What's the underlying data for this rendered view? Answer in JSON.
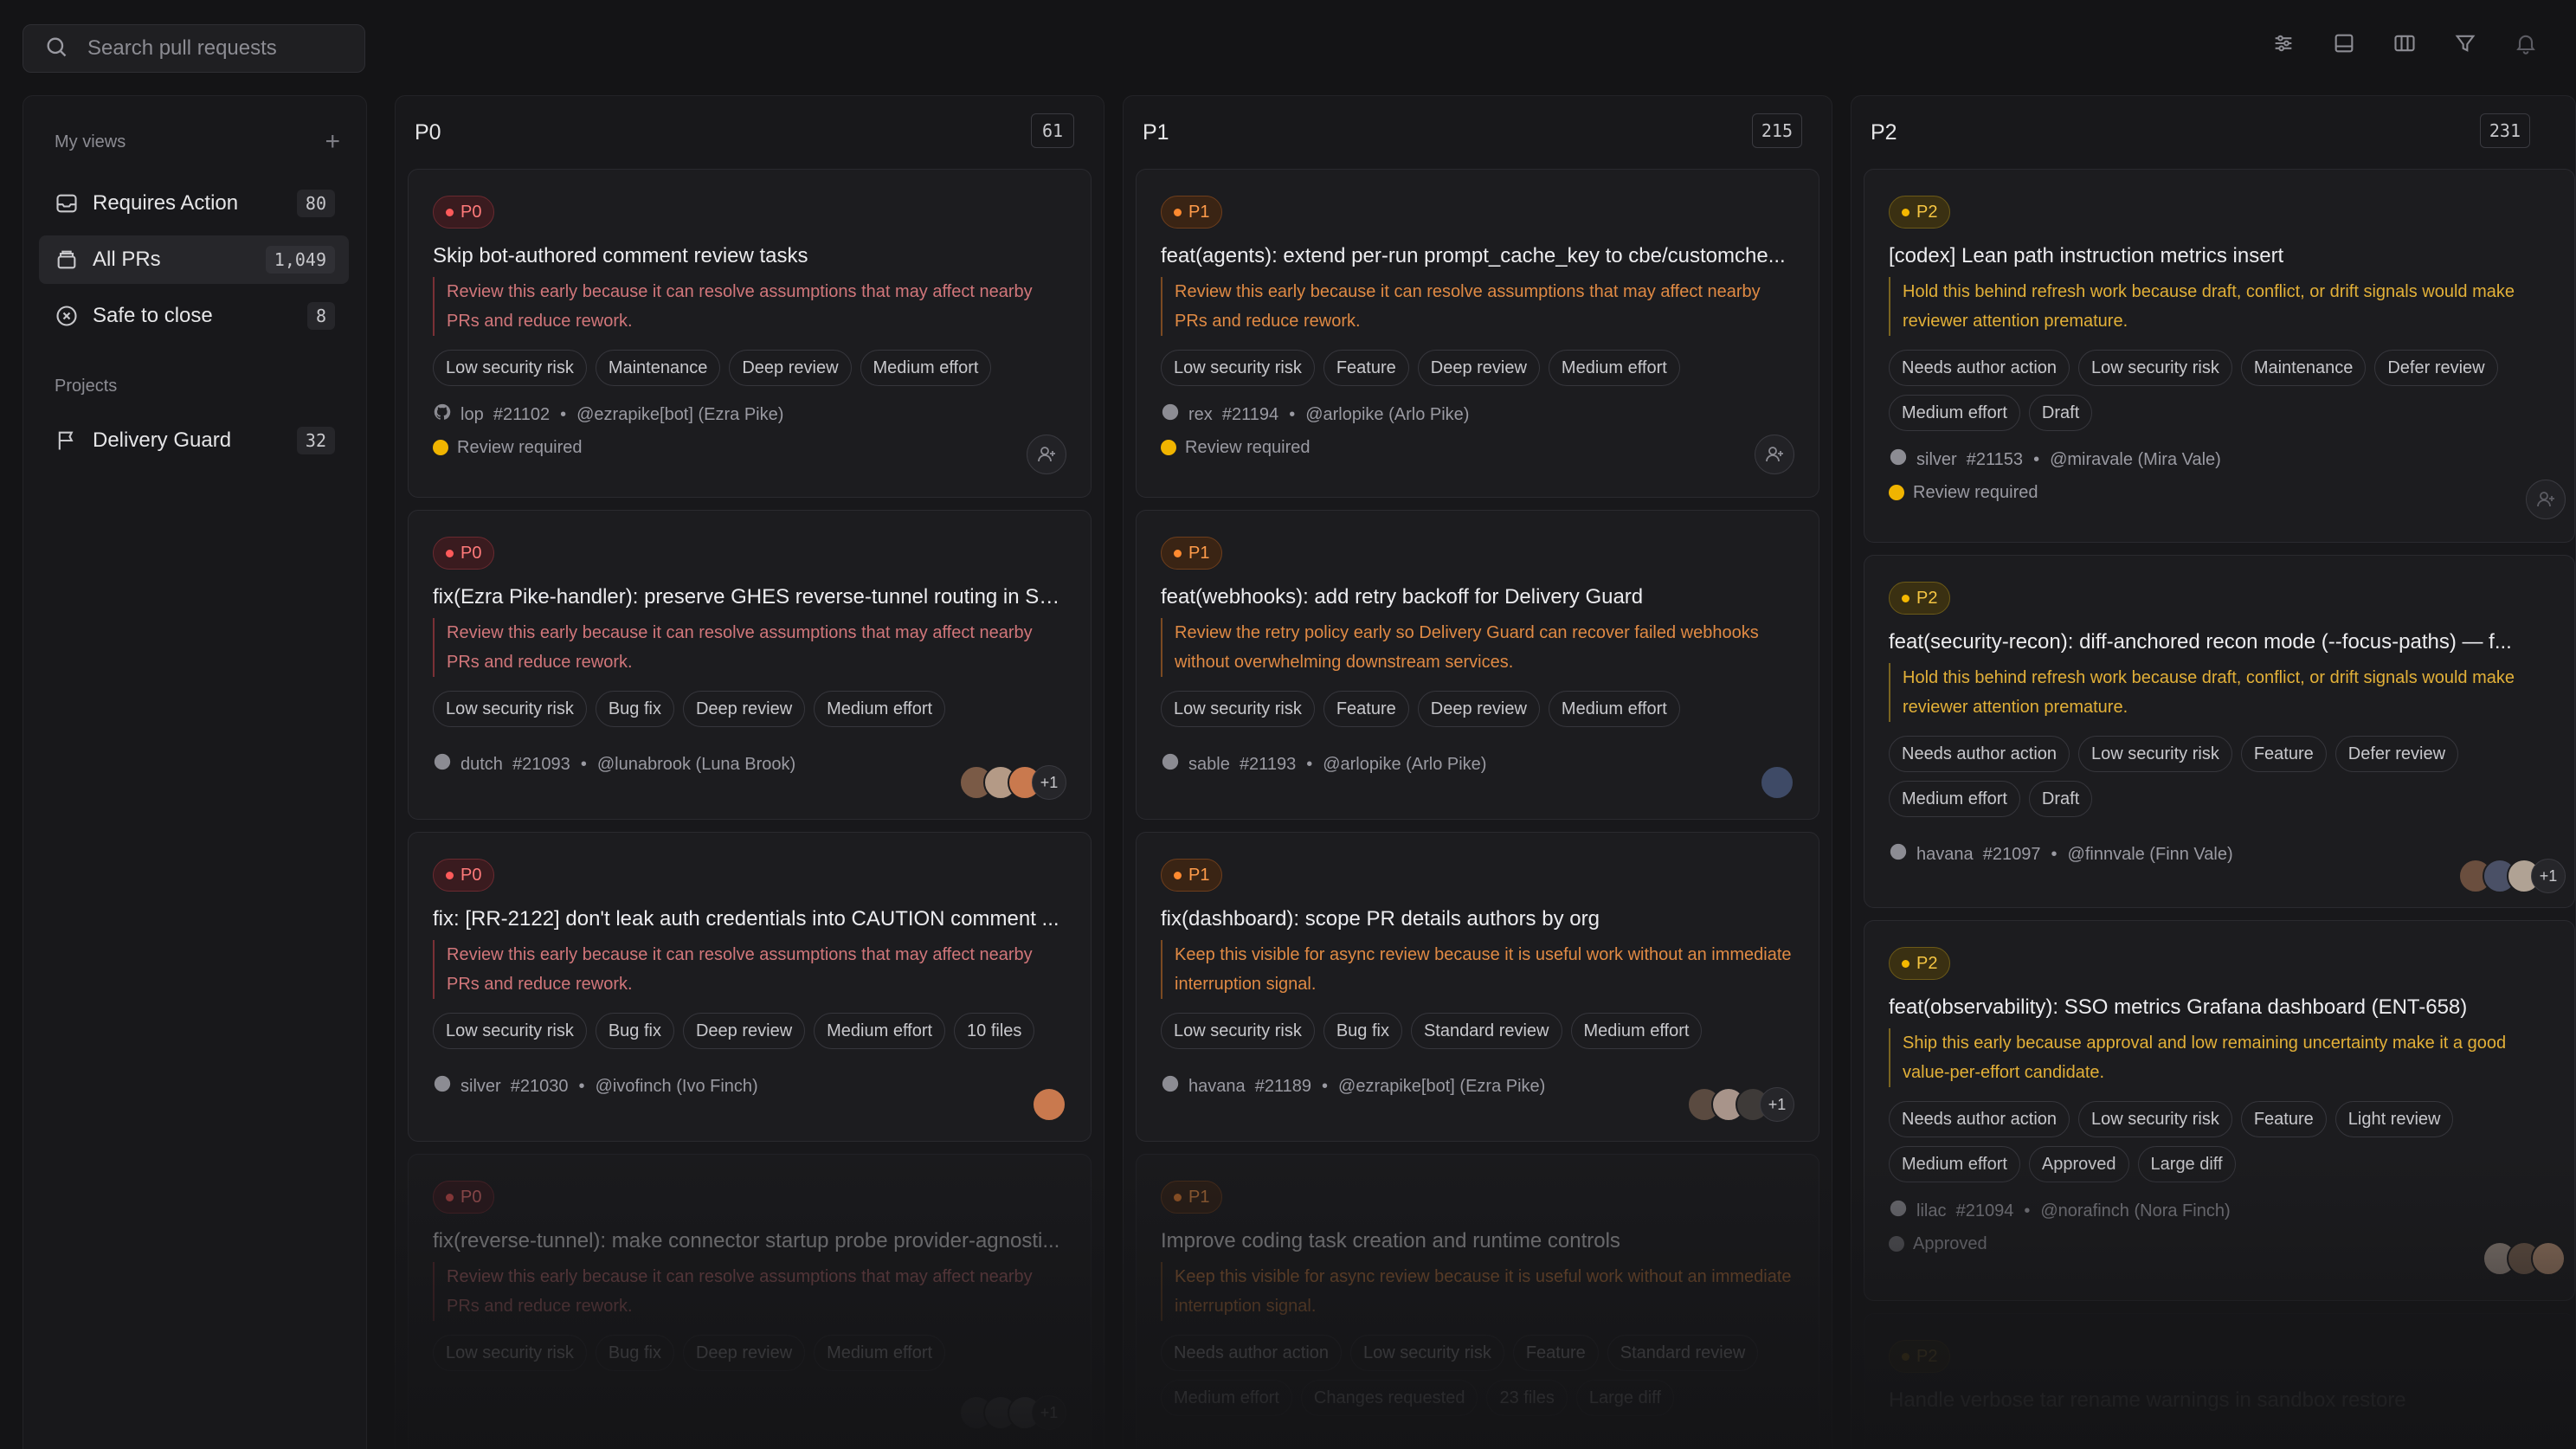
{
  "search": {
    "placeholder": "Search pull requests"
  },
  "toolbar": {
    "icons": [
      "sliders-icon",
      "layout-icon",
      "columns-icon",
      "filter-icon",
      "bell-icon"
    ]
  },
  "sidebar": {
    "my_views_label": "My views",
    "add_label": "+",
    "views": [
      {
        "label": "Requires Action",
        "count": "80",
        "icon": "inbox-icon"
      },
      {
        "label": "All PRs",
        "count": "1,049",
        "icon": "stack-icon"
      },
      {
        "label": "Safe to close",
        "count": "8",
        "icon": "close-circle-icon"
      }
    ],
    "projects_label": "Projects",
    "projects": [
      {
        "label": "Delivery Guard",
        "count": "32",
        "icon": "flag-icon"
      }
    ]
  },
  "colors": {
    "p0": "#ff5a5a",
    "p1": "#ff8a30",
    "p2": "#f5b800",
    "background": "#141416"
  },
  "columns": [
    {
      "title": "P0",
      "count": "61",
      "cards": [
        {
          "badge": "P0",
          "title": "Skip bot-authored comment review tasks",
          "note": "Review this early because it can resolve assumptions that may affect nearby PRs and reduce rework.",
          "tags": [
            "Low security risk",
            "Maintenance",
            "Deep review",
            "Medium effort"
          ],
          "repo": "lop",
          "number": "#21102",
          "author": "@ezrapike[bot] (Ezra Pike)",
          "status": "Review required"
        },
        {
          "badge": "P0",
          "title": "fix(Ezra Pike-handler): preserve GHES reverse-tunnel routing in SS...",
          "note": "Review this early because it can resolve assumptions that may affect nearby PRs and reduce rework.",
          "tags": [
            "Low security risk",
            "Bug fix",
            "Deep review",
            "Medium effort"
          ],
          "repo": "dutch",
          "number": "#21093",
          "author": "@lunabrook (Luna Brook)",
          "more": "+1"
        },
        {
          "badge": "P0",
          "title": "fix: [RR-2122] don't leak auth credentials into CAUTION comment ...",
          "note": "Review this early because it can resolve assumptions that may affect nearby PRs and reduce rework.",
          "tags": [
            "Low security risk",
            "Bug fix",
            "Deep review",
            "Medium effort",
            "10 files"
          ],
          "repo": "silver",
          "number": "#21030",
          "author": "@ivofinch (Ivo Finch)"
        },
        {
          "badge": "P0",
          "title": "fix(reverse-tunnel): make connector startup probe provider-agnosti...",
          "note": "Review this early because it can resolve assumptions that may affect nearby PRs and reduce rework.",
          "tags": [
            "Low security risk",
            "Bug fix",
            "Deep review",
            "Medium effort"
          ],
          "more": "+1"
        }
      ]
    },
    {
      "title": "P1",
      "count": "215",
      "cards": [
        {
          "badge": "P1",
          "title": "feat(agents): extend per-run prompt_cache_key to cbe/customche...",
          "note": "Review this early because it can resolve assumptions that may affect nearby PRs and reduce rework.",
          "tags": [
            "Low security risk",
            "Feature",
            "Deep review",
            "Medium effort"
          ],
          "repo": "rex",
          "number": "#21194",
          "author": "@arlopike (Arlo Pike)",
          "status": "Review required"
        },
        {
          "badge": "P1",
          "title": "feat(webhooks): add retry backoff for Delivery Guard",
          "note": "Review the retry policy early so Delivery Guard can recover failed webhooks without overwhelming downstream services.",
          "tags": [
            "Low security risk",
            "Feature",
            "Deep review",
            "Medium effort"
          ],
          "repo": "sable",
          "number": "#21193",
          "author": "@arlopike (Arlo Pike)"
        },
        {
          "badge": "P1",
          "title": "fix(dashboard): scope PR details authors by org",
          "note": "Keep this visible for async review because it is useful work without an immediate interruption signal.",
          "tags": [
            "Low security risk",
            "Bug fix",
            "Standard review",
            "Medium effort"
          ],
          "repo": "havana",
          "number": "#21189",
          "author": "@ezrapike[bot] (Ezra Pike)",
          "more": "+1"
        },
        {
          "badge": "P1",
          "title": "Improve coding task creation and runtime controls",
          "note": "Keep this visible for async review because it is useful work without an immediate interruption signal.",
          "tags": [
            "Needs author action",
            "Low security risk",
            "Feature",
            "Standard review",
            "Medium effort",
            "Changes requested",
            "23 files",
            "Large diff"
          ]
        }
      ]
    },
    {
      "title": "P2",
      "count": "231",
      "cards": [
        {
          "badge": "P2",
          "title": "[codex] Lean path instruction metrics insert",
          "note": "Hold this behind refresh work because draft, conflict, or drift signals would make reviewer attention premature.",
          "tags": [
            "Needs author action",
            "Low security risk",
            "Maintenance",
            "Defer review",
            "Medium effort",
            "Draft"
          ],
          "repo": "silver",
          "number": "#21153",
          "author": "@miravale (Mira Vale)",
          "status": "Review required"
        },
        {
          "badge": "P2",
          "title": "feat(security-recon): diff-anchored recon mode (--focus-paths) — f...",
          "note": "Hold this behind refresh work because draft, conflict, or drift signals would make reviewer attention premature.",
          "tags": [
            "Needs author action",
            "Low security risk",
            "Feature",
            "Defer review",
            "Medium effort",
            "Draft"
          ],
          "repo": "havana",
          "number": "#21097",
          "author": "@finnvale (Finn Vale)",
          "more": "+1"
        },
        {
          "badge": "P2",
          "title": "feat(observability): SSO metrics Grafana dashboard (ENT-658)",
          "note": "Ship this early because approval and low remaining uncertainty make it a good value-per-effort candidate.",
          "tags": [
            "Needs author action",
            "Low security risk",
            "Feature",
            "Light review",
            "Medium effort",
            "Approved",
            "Large diff"
          ],
          "repo": "lilac",
          "number": "#21094",
          "author": "@norafinch (Nora Finch)",
          "status": "Approved"
        },
        {
          "badge": "P2",
          "title": "Handle verbose tar rename warnings in sandbox restore"
        }
      ]
    }
  ]
}
